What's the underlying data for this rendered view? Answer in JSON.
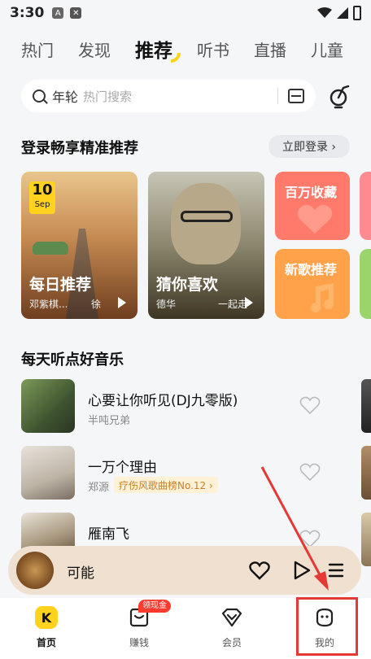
{
  "status_bar": {
    "time": "3:30",
    "icon1_text": "A"
  },
  "top_tabs": [
    {
      "label": "热门"
    },
    {
      "label": "发现"
    },
    {
      "label": "推荐",
      "active": true
    },
    {
      "label": "听书"
    },
    {
      "label": "直播"
    },
    {
      "label": "儿童"
    }
  ],
  "search": {
    "keyword": "年轮",
    "hint": "热门搜索"
  },
  "login": {
    "title": "登录畅享精准推荐",
    "button": "立即登录 ›"
  },
  "cards": {
    "daily": {
      "date_day": "10",
      "date_month": "Sep",
      "title": "每日推荐",
      "subtitle": "邓紫棋...",
      "subtitle_right": "徐"
    },
    "guess": {
      "title": "猜你喜欢",
      "subtitle": "德华",
      "subtitle_right": "一起走"
    },
    "favorites": {
      "title": "百万收藏"
    },
    "new_songs": {
      "title": "新歌推荐"
    }
  },
  "daily_music": {
    "title": "每天听点好音乐",
    "songs": [
      {
        "title": "心要让你听见(DJ九零版)",
        "artist": "半吨兄弟",
        "tag": ""
      },
      {
        "title": "一万个理由",
        "artist": "郑源",
        "tag": "疗伤风歌曲榜No.12 ›"
      },
      {
        "title": "雁南飞",
        "artist": "",
        "tag": ""
      }
    ]
  },
  "mini_player": {
    "title": "可能"
  },
  "bottom_nav": [
    {
      "label": "首页",
      "active": true,
      "icon": "home-icon"
    },
    {
      "label": "赚钱",
      "badge": "领现金",
      "icon": "wallet-icon"
    },
    {
      "label": "会员",
      "icon": "vip-icon"
    },
    {
      "label": "我的",
      "icon": "profile-icon"
    }
  ],
  "colors": {
    "accent": "#FFD21E",
    "highlight": "#E53935"
  }
}
